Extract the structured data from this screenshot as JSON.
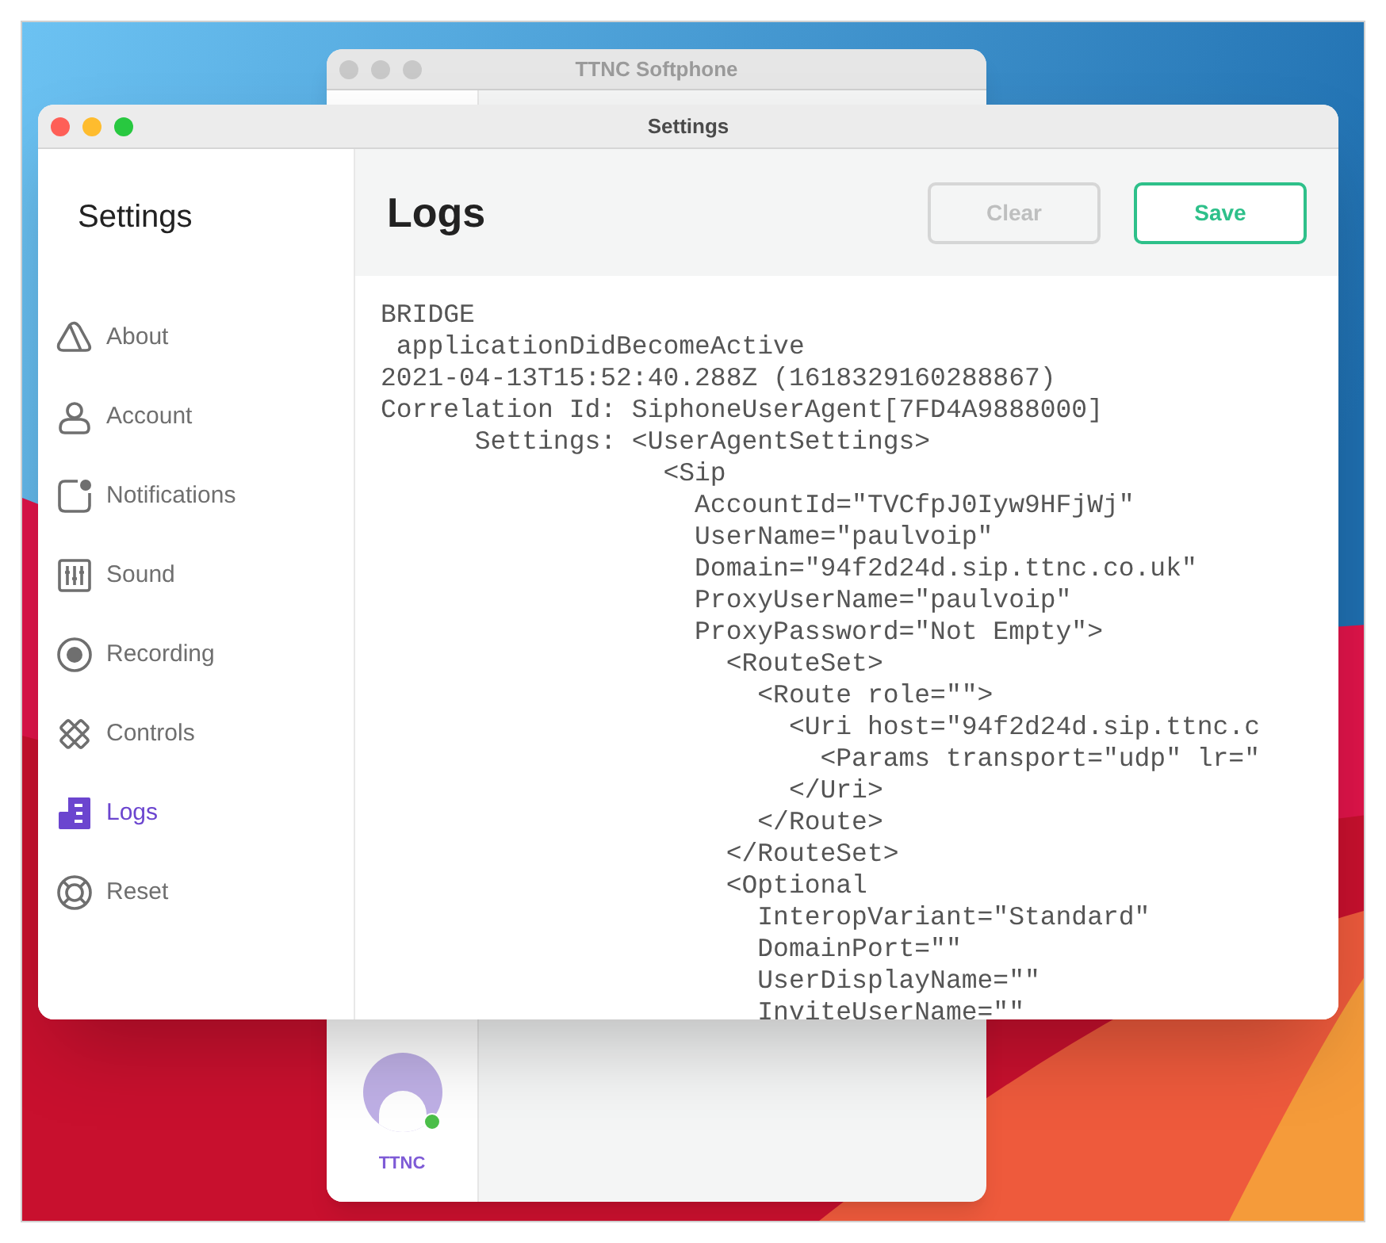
{
  "background_window": {
    "title": "TTNC Softphone",
    "account_label": "TTNC",
    "online": true
  },
  "settings_window": {
    "title": "Settings",
    "sidebar": {
      "title": "Settings",
      "items": [
        {
          "label": "About",
          "selected": false
        },
        {
          "label": "Account",
          "selected": false
        },
        {
          "label": "Notifications",
          "selected": false
        },
        {
          "label": "Sound",
          "selected": false
        },
        {
          "label": "Recording",
          "selected": false
        },
        {
          "label": "Controls",
          "selected": false
        },
        {
          "label": "Logs",
          "selected": true
        },
        {
          "label": "Reset",
          "selected": false
        }
      ]
    },
    "header": {
      "title": "Logs",
      "buttons": [
        {
          "label": "Clear",
          "kind": "secondary",
          "disabled": true
        },
        {
          "label": "Save",
          "kind": "primary",
          "disabled": false
        }
      ]
    },
    "log_lines": [
      "BRIDGE",
      " applicationDidBecomeActive",
      "2021-04-13T15:52:40.288Z (1618329160288867)",
      "Correlation Id: SiphoneUserAgent[7FD4A9888000]",
      "      Settings: <UserAgentSettings>",
      "                  <Sip",
      "                    AccountId=\"TVCfpJ0Iyw9HFjWj\"",
      "                    UserName=\"paulvoip\"",
      "                    Domain=\"94f2d24d.sip.ttnc.co.uk\"",
      "                    ProxyUserName=\"paulvoip\"",
      "                    ProxyPassword=\"Not Empty\">",
      "                      <RouteSet>",
      "                        <Route role=\"\">",
      "                          <Uri host=\"94f2d24d.sip.ttnc.c",
      "                            <Params transport=\"udp\" lr=\"",
      "                          </Uri>",
      "                        </Route>",
      "                      </RouteSet>",
      "                      <Optional",
      "                        InteropVariant=\"Standard\"",
      "                        DomainPort=\"\"",
      "                        UserDisplayName=\"\"",
      "                        InviteUserName=\"\""
    ]
  }
}
